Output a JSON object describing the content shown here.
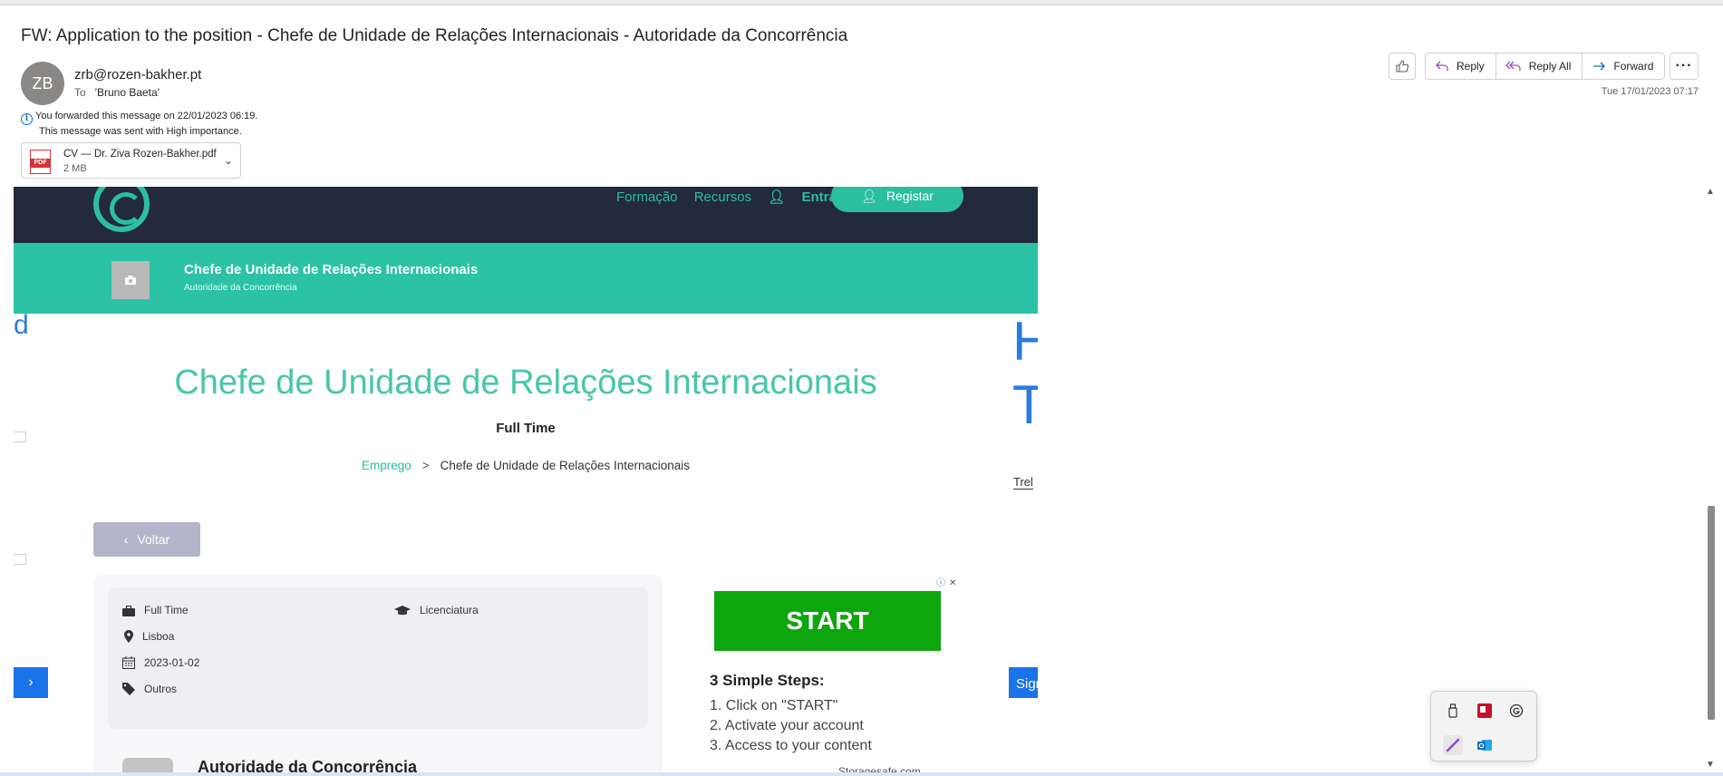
{
  "email": {
    "subject": "FW: Application to the position - Chefe de Unidade de Relações Internacionais - Autoridade da Concorrência",
    "avatar_initials": "ZB",
    "sender": "zrb@rozen-bakher.pt",
    "to_label": "To",
    "to_value": "'Bruno Baeta'",
    "forward_info": "You forwarded this message on 22/01/2023 06:19.",
    "importance_info": "This message was sent with High importance.",
    "date": "Tue 17/01/2023 07:17",
    "attachment": {
      "icon_label": "PDF",
      "name": "CV — Dr. Ziva Rozen-Bakher.pdf",
      "size": "2 MB"
    }
  },
  "toolbar": {
    "reply": "Reply",
    "reply_all": "Reply All",
    "forward": "Forward",
    "more": "···"
  },
  "site": {
    "nav": {
      "formacao": "Formação",
      "recursos": "Recursos",
      "entrar": "Entrar",
      "registar": "Registar"
    },
    "band": {
      "title": "Chefe de Unidade de Relações Internacionais",
      "subtitle": "Autoridade da Concorrência"
    },
    "job_title": "Chefe de Unidade de Relações Internacionais",
    "job_type": "Full Time",
    "breadcrumb": {
      "root": "Emprego",
      "separator": ">",
      "current": "Chefe de Unidade de Relações Internacionais"
    },
    "back_label": "Voltar",
    "details": {
      "type": "Full Time",
      "education": "Licenciatura",
      "location": "Lisboa",
      "date": "2023-01-02",
      "category": "Outros"
    },
    "company": "Autoridade da Concorrência",
    "side_left_text": "d",
    "side_right_text": "H\nT",
    "side_right_link": "Trel",
    "side_right_button": "Sign"
  },
  "ad": {
    "button": "START",
    "title": "3 Simple Steps:",
    "steps": [
      "1. Click on \"START\"",
      "2. Activate your account",
      "3. Access to your content"
    ],
    "footer": "Storagesafe.com"
  },
  "colors": {
    "accent": "#2bbfa0",
    "nav_bg": "#232a3b",
    "band_bg": "#2bc2a6",
    "ad_green": "#0ea60e",
    "link_blue": "#0f6cbd"
  }
}
